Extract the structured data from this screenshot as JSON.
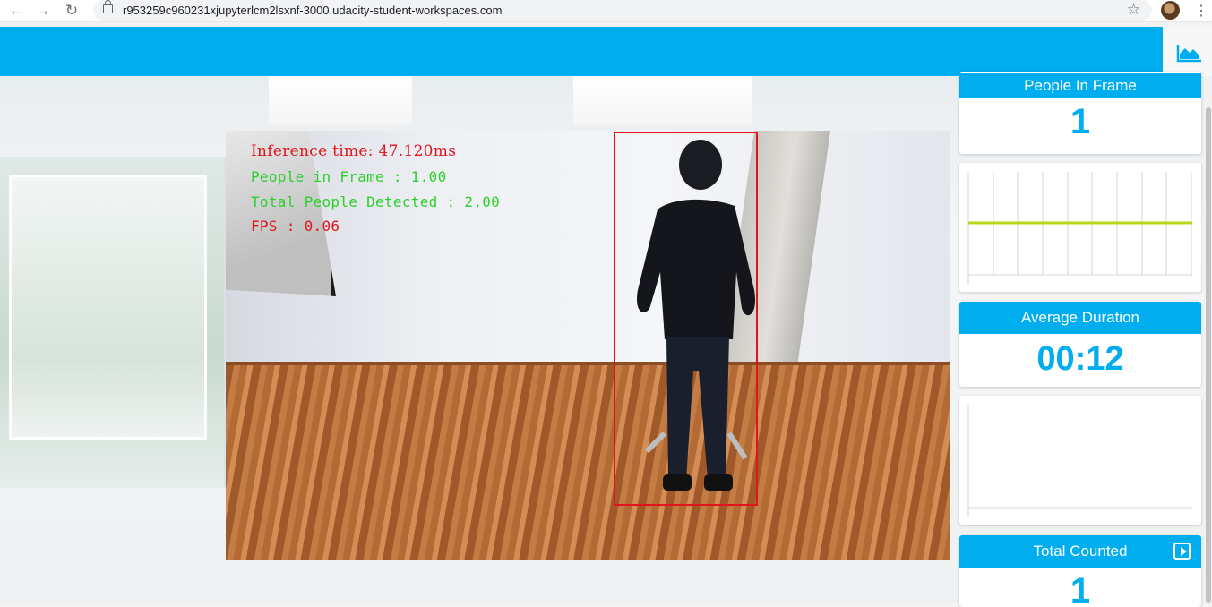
{
  "browser": {
    "url": "r953259c960231xjupyterlcm2lsxnf-3000.udacity-student-workspaces.com",
    "nav_back_icon": "arrow-left-icon",
    "nav_forward_icon": "arrow-right-icon",
    "reload_icon": "reload-icon",
    "bookmark_icon": "star-icon",
    "menu_icon": "more-vert-icon"
  },
  "appbar": {
    "color": "#00aeef",
    "icon": "area-chart-icon"
  },
  "video": {
    "overlay": {
      "inference": "Inference time: 47.120ms",
      "people_in_frame": "People in Frame : 1.00",
      "total_detected": "Total People Detected : 2.00",
      "fps": "FPS : 0.06"
    },
    "overlay_colors": {
      "inference": "#e0141b",
      "people_in_frame": "#2bd12b",
      "total_detected": "#2bd12b",
      "fps": "#e0141b"
    },
    "bbox_color": "#e0141b"
  },
  "stats": {
    "people_in_frame": {
      "label": "People In Frame",
      "value": "1"
    },
    "average_duration": {
      "label": "Average Duration",
      "value": "00:12"
    },
    "total_counted": {
      "label": "Total Counted",
      "value": "1",
      "icon": "play-box-icon"
    }
  },
  "chart_people": {
    "line_color": "#b9d51a",
    "series_value": 1
  }
}
